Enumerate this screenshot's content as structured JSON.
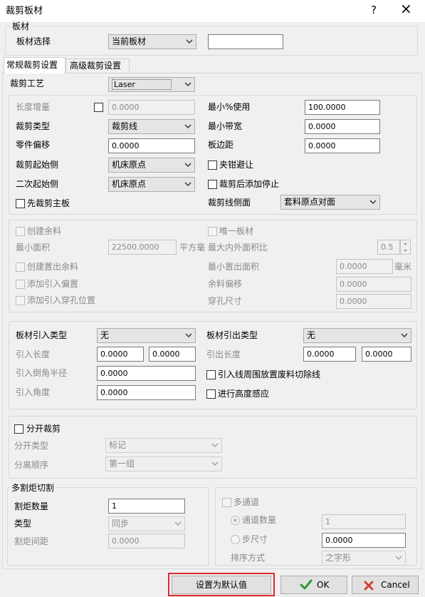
{
  "window": {
    "title": "裁剪板材",
    "help_glyph": "?",
    "close_glyph": "×"
  },
  "sheet_group": {
    "title": "板材",
    "select_label": "板材选择",
    "select_value": "当前板材",
    "extra_value": ""
  },
  "tabs": {
    "general": "常规裁剪设置",
    "advanced": "高级裁剪设置"
  },
  "cutting": {
    "process_label": "裁剪工艺",
    "process_value": "Laser",
    "length_increment_label": "长度增量",
    "length_increment_value": "0.0000",
    "cut_type_label": "裁剪类型",
    "cut_type_value": "裁剪线",
    "part_offset_label": "零件偏移",
    "part_offset_value": "0.0000",
    "start_side_label": "裁剪起始侧",
    "start_side_value": "机床原点",
    "second_start_side_label": "二次起始侧",
    "second_start_side_value": "机床原点",
    "cut_main_first_label": "先裁剪主板",
    "min_percent_label": "最小%使用",
    "min_percent_value": "100.0000",
    "min_band_label": "最小带宽",
    "min_band_value": "0.0000",
    "sheet_margin_label": "板边距",
    "sheet_margin_value": "0.0000",
    "clamp_avoid_label": "夹钳避让",
    "add_stop_label": "裁剪后添加停止",
    "cutline_side_label": "裁剪线侧面",
    "cutline_side_value": "套料原点对面"
  },
  "remnant": {
    "create_label": "创建余料",
    "unique_label": "唯一板材",
    "min_area_label": "最小面积",
    "min_area_value": "22500.0000",
    "area_unit": "平方毫",
    "max_inner_label": "最大内外面积比",
    "max_inner_value": "0.5",
    "create_out_label": "创建置出余料",
    "min_out_area_label": "最小置出面积",
    "min_out_area_value": "0.0000",
    "mm_unit": "毫米",
    "add_lead_offset_label": "添加引入偏置",
    "remnant_offset_label": "余料偏移",
    "remnant_offset_value": "0.0000",
    "add_pierce_label": "添加引入穿孔位置",
    "pierce_size_label": "穿孔尺寸",
    "pierce_size_value": "0.0000"
  },
  "leads": {
    "lead_in_type_label": "板材引入类型",
    "lead_in_type_value": "无",
    "lead_out_type_label": "板材引出类型",
    "lead_out_type_value": "无",
    "lead_in_length_label": "引入长度",
    "lead_in_length_1": "0.0000",
    "lead_in_length_2": "0.0000",
    "lead_out_length_label": "引出长度",
    "lead_out_length_1": "0.0000",
    "lead_out_length_2": "0.0000",
    "lead_in_chamfer_label": "引入倒角半径",
    "lead_in_chamfer_value": "0.0000",
    "scrap_cut_label": "引入线周围放置废料切除线",
    "lead_in_angle_label": "引入角度",
    "lead_in_angle_value": "0.0000",
    "height_sense_label": "进行高度感应"
  },
  "split": {
    "split_label": "分开裁剪",
    "split_type_label": "分开类型",
    "split_type_value": "标记",
    "split_order_label": "分离顺序",
    "split_order_value": "第一组"
  },
  "torch": {
    "title": "多割炬切割",
    "count_label": "割炬数量",
    "count_value": "1",
    "type_label": "类型",
    "type_value": "同步",
    "spacing_label": "割炬间距",
    "spacing_value": "0.0000"
  },
  "channel": {
    "multi_label": "多通道",
    "count_label": "通道数量",
    "count_value": "1",
    "step_label": "步尺寸",
    "step_value": "0.0000",
    "sort_label": "排序方式",
    "sort_value": "之字形"
  },
  "buttons": {
    "set_default": "设置为默认值",
    "ok": "OK",
    "cancel": "Cancel"
  },
  "colors": {
    "highlight": "#e0292d",
    "ok_check": "#2b9a35",
    "cancel_x": "#d9382f"
  }
}
